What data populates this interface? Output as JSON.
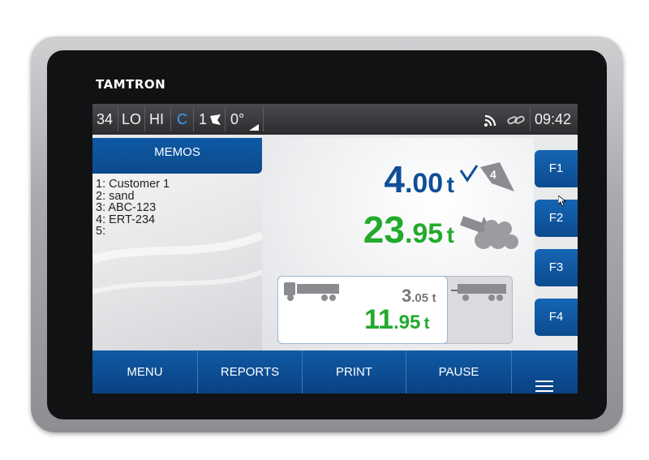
{
  "brand": "TAMTRON",
  "status_bar": {
    "items": [
      "34",
      "LO",
      "HI",
      "C",
      "1",
      "0°"
    ],
    "time": "09:42",
    "accent_color": "#3aa0ff",
    "icons": [
      "flag-icon",
      "tilt-icon",
      "wifi-icon",
      "link-icon"
    ]
  },
  "memos": {
    "title": "MEMOS",
    "lines": [
      "1: Customer 1",
      "2: sand",
      "3: ABC-123",
      "4: ERT-234",
      "5:"
    ]
  },
  "weights": {
    "current": {
      "int": "4",
      "dec": ".00",
      "unit": "t",
      "badge": "4"
    },
    "total": {
      "int": "23",
      "dec": ".95",
      "unit": "t"
    }
  },
  "vehicles": {
    "truck": {
      "int": "3",
      "dec": ".05",
      "unit": "t"
    },
    "trailer": {
      "int": "11",
      "dec": ".95",
      "unit": "t"
    }
  },
  "function_keys": [
    "F1",
    "F2",
    "F3",
    "F4"
  ],
  "bottom_menu": [
    "MENU",
    "REPORTS",
    "PRINT",
    "PAUSE"
  ],
  "colors": {
    "blue": "#0f4f98",
    "green": "#22aa2c",
    "nav": "#0f5aa5"
  }
}
